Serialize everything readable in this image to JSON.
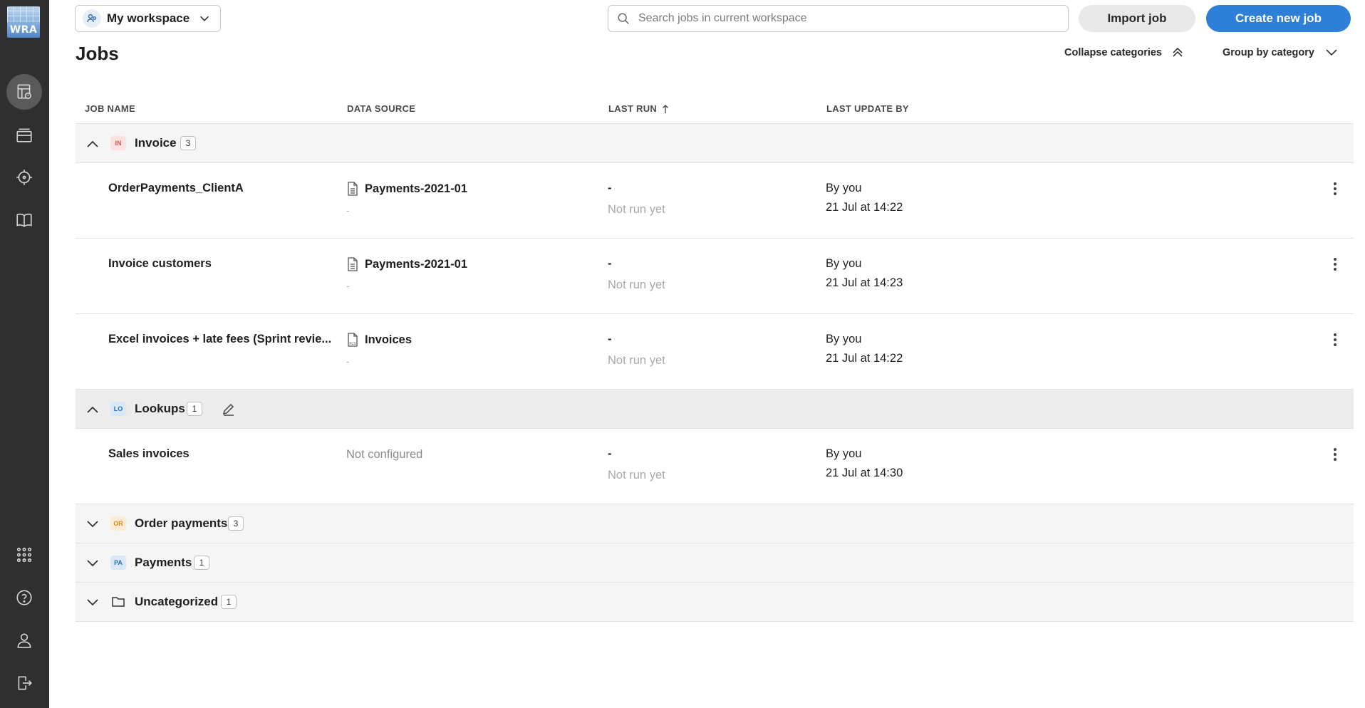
{
  "sidebar": {
    "logo_text": "WRA",
    "items": [
      {
        "name": "jobs",
        "icon": "jobs-icon",
        "active": true
      },
      {
        "name": "files",
        "icon": "folder-stack-icon",
        "active": false
      },
      {
        "name": "target",
        "icon": "crosshair-icon",
        "active": false
      },
      {
        "name": "docs",
        "icon": "book-icon",
        "active": false
      }
    ],
    "bottom": [
      {
        "name": "apps",
        "icon": "app-grid-icon"
      },
      {
        "name": "help",
        "icon": "help-icon"
      },
      {
        "name": "account",
        "icon": "user-icon"
      },
      {
        "name": "logout",
        "icon": "logout-icon"
      }
    ]
  },
  "topbar": {
    "workspace_label": "My workspace",
    "search_placeholder": "Search jobs in current workspace",
    "import_label": "Import job",
    "create_label": "Create new job"
  },
  "page": {
    "title": "Jobs",
    "collapse_label": "Collapse categories",
    "group_label": "Group by category"
  },
  "columns": [
    "JOB NAME",
    "DATA SOURCE",
    "LAST RUN",
    "LAST UPDATE BY"
  ],
  "categories": [
    {
      "badge": "IN",
      "badge_bg": "#fbe2e0",
      "badge_fg": "#d9534f",
      "name": "Invoice",
      "count": "3",
      "expanded": true,
      "jobs": [
        {
          "name": "OrderPayments_ClientA",
          "source": "Payments-2021-01",
          "source_icon": "document-icon",
          "source_sub": "-",
          "last_run": "-",
          "last_run_sub": "Not run yet",
          "by": "By you",
          "when": "21 Jul at 14:22"
        },
        {
          "name": "Invoice customers",
          "source": "Payments-2021-01",
          "source_icon": "document-icon",
          "source_sub": "-",
          "last_run": "-",
          "last_run_sub": "Not run yet",
          "by": "By you",
          "when": "21 Jul at 14:23"
        },
        {
          "name": "Excel invoices + late fees (Sprint revie...",
          "source": "Invoices",
          "source_icon": "xls-file-icon",
          "source_sub": "-",
          "last_run": "-",
          "last_run_sub": "Not run yet",
          "by": "By you",
          "when": "21 Jul at 14:22"
        }
      ]
    },
    {
      "badge": "LO",
      "badge_bg": "#d8e8f8",
      "badge_fg": "#2d6fb8",
      "name": "Lookups",
      "count": "1",
      "expanded": true,
      "jobs": [
        {
          "name": "Sales invoices",
          "source_none": "Not configured",
          "last_run": "-",
          "last_run_sub": "Not run yet",
          "by": "By you",
          "when": "21 Jul at 14:30"
        }
      ]
    },
    {
      "badge": "OR",
      "badge_bg": "#fdecd3",
      "badge_fg": "#d98a1c",
      "name": "Order payments",
      "count": "3",
      "expanded": false
    },
    {
      "badge": "PA",
      "badge_bg": "#d8e8f8",
      "badge_fg": "#2d6fb8",
      "name": "Payments",
      "count": "1",
      "expanded": false
    },
    {
      "badge": "",
      "name": "Uncategorized",
      "count": "1",
      "expanded": false,
      "folder": true
    }
  ]
}
